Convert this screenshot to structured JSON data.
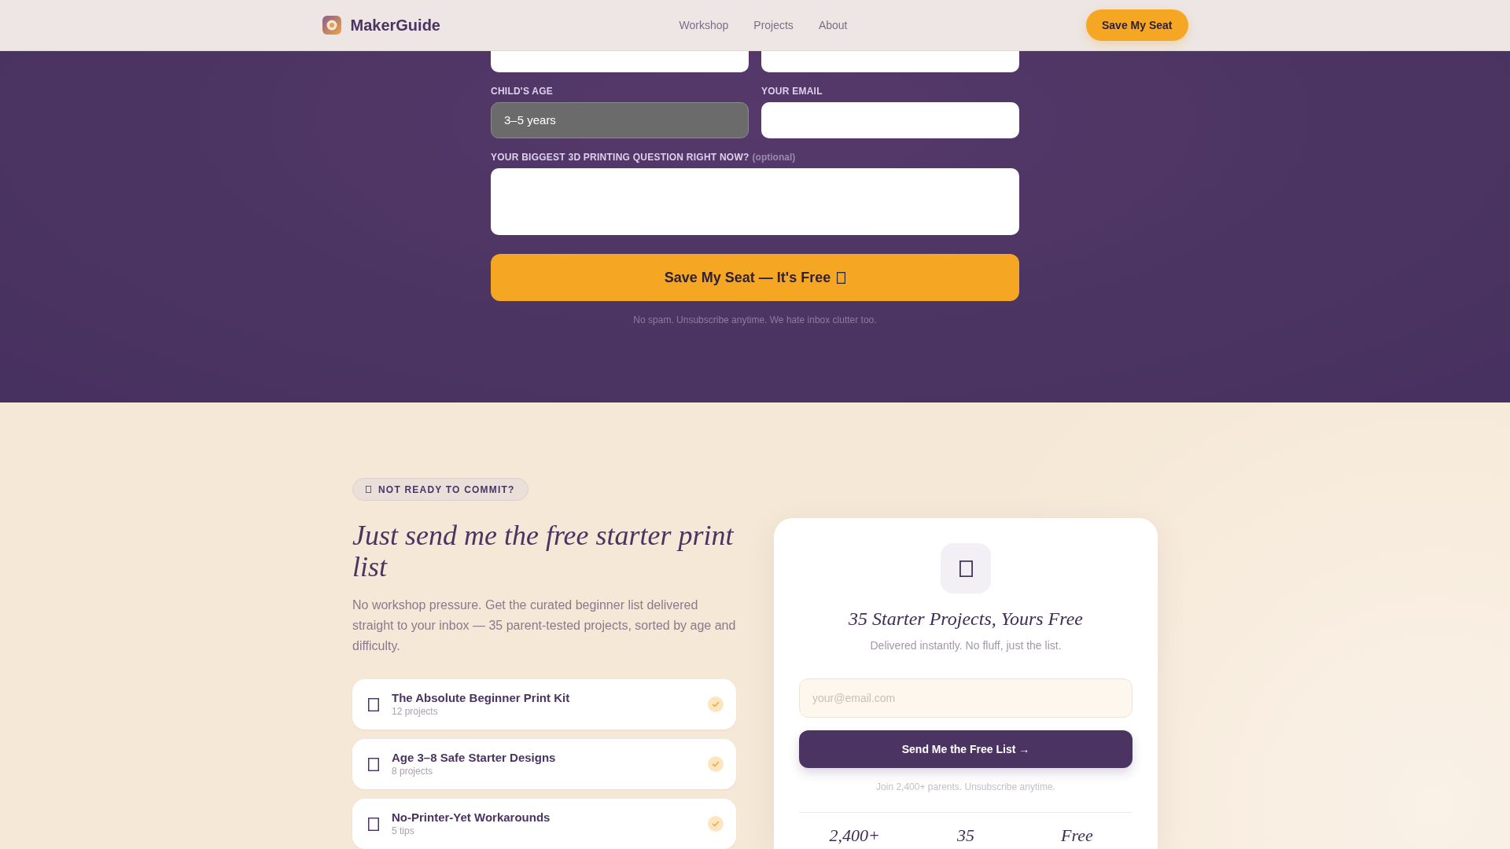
{
  "header": {
    "brand": "MakerGuide",
    "nav": [
      "Workshop",
      "Projects",
      "About"
    ],
    "cta": "Save My Seat"
  },
  "signup_form": {
    "fields": [
      {
        "kind": "text"
      },
      {
        "kind": "text"
      },
      {
        "kind": "select",
        "label": "CHILD'S AGE",
        "value": "3–5 years"
      },
      {
        "kind": "text",
        "label": "YOUR EMAIL"
      },
      {
        "kind": "textarea",
        "label": "YOUR BIGGEST 3D PRINTING QUESTION RIGHT NOW?",
        "hint": "(optional)"
      }
    ],
    "submit": "Save My Seat — It's Free",
    "note": "No spam. Unsubscribe anytime. We hate inbox clutter too."
  },
  "starter_list": {
    "badge": "NOT READY TO COMMIT?",
    "heading": "Just send me the free starter print list",
    "intro": "No workshop pressure. Get the curated beginner list delivered straight to your inbox — 35 parent-tested projects, sorted by age and difficulty.",
    "items": [
      {
        "title": "The Absolute Beginner Print Kit",
        "count": "12 projects",
        "checked": true
      },
      {
        "title": "Age 3–8 Safe Starter Designs",
        "count": "8 projects",
        "checked": true
      },
      {
        "title": "No-Printer-Yet Workarounds",
        "count": "5 tips",
        "checked": true
      }
    ]
  },
  "free_list_card": {
    "title": "35 Starter Projects, Yours Free",
    "subtitle": "Delivered instantly. No fluff, just the list.",
    "email_placeholder": "your@email.com",
    "button": "Send Me the Free List →",
    "note": "Join 2,400+ parents. Unsubscribe anytime.",
    "stats": [
      "2,400+",
      "35",
      "Free"
    ]
  }
}
